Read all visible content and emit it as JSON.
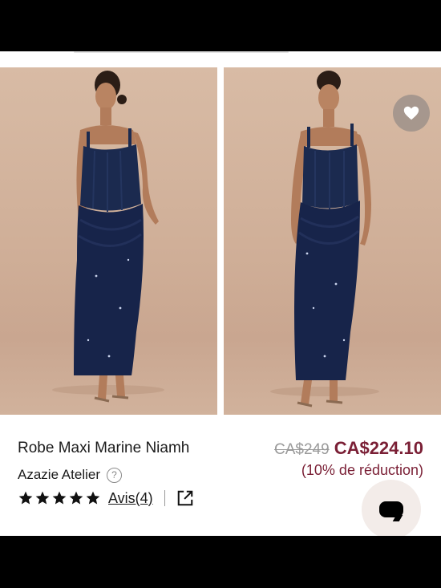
{
  "product": {
    "title": "Robe Maxi Marine Niamh",
    "brand": "Azazie Atelier",
    "rating_stars": 5,
    "reviews_label": "Avis(4)",
    "old_price": "CA$249",
    "new_price": "CA$224.10",
    "discount": "(10% de réduction)"
  },
  "colors": {
    "price_accent": "#7a1f35",
    "dress_navy": "#1b2a4f",
    "photo_background": "#d2b39d"
  },
  "icons": {
    "wishlist": "heart-icon",
    "help": "question-circle-icon",
    "share": "external-link-icon",
    "chat": "chat-bubble-icon",
    "rating": "star-icon"
  },
  "help_glyph": "?"
}
